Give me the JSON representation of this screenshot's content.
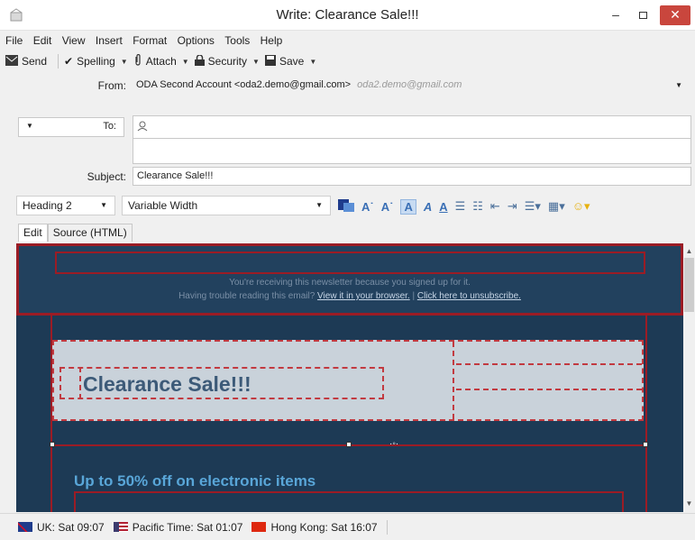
{
  "window": {
    "title": "Write: Clearance Sale!!!",
    "minimize_label": "–",
    "close_label": "✕"
  },
  "menu": [
    {
      "label": "File"
    },
    {
      "label": "Edit"
    },
    {
      "label": "View"
    },
    {
      "label": "Insert"
    },
    {
      "label": "Format"
    },
    {
      "label": "Options"
    },
    {
      "label": "Tools"
    },
    {
      "label": "Help"
    }
  ],
  "toolbar": {
    "send_label": "Send",
    "spelling_label": "Spelling",
    "attach_label": "Attach",
    "security_label": "Security",
    "save_label": "Save"
  },
  "compose": {
    "from_label": "From:",
    "from_value": "ODA Second Account <oda2.demo@gmail.com>",
    "from_alt": "oda2.demo@gmail.com",
    "to_label": "To:",
    "subject_label": "Subject:",
    "subject_value": "Clearance Sale!!!"
  },
  "format_bar": {
    "paragraph_style": "Heading 2",
    "font": "Variable Width"
  },
  "tabs": [
    {
      "label": "Edit"
    },
    {
      "label": "Source (HTML)"
    }
  ],
  "email": {
    "notice_line1": "You're receiving this newsletter because you signed up for it.",
    "notice_line2_prefix": "Having trouble reading this email?",
    "view_link": "View it in your browser.",
    "separator": "|",
    "unsubscribe_link": "Click here to unsubscribe.",
    "headline": "Clearance Sale!!!",
    "promo_heading": "Up to 50% off on electronic items"
  },
  "statusbar": [
    {
      "label": "UK: Sat 09:07"
    },
    {
      "label": "Pacific Time: Sat 01:07"
    },
    {
      "label": "Hong Kong: Sat 16:07"
    }
  ],
  "colors": {
    "editor_bg": "#1d3a55",
    "frame_red": "#9b1c25",
    "promo_blue": "#59a6d8"
  }
}
